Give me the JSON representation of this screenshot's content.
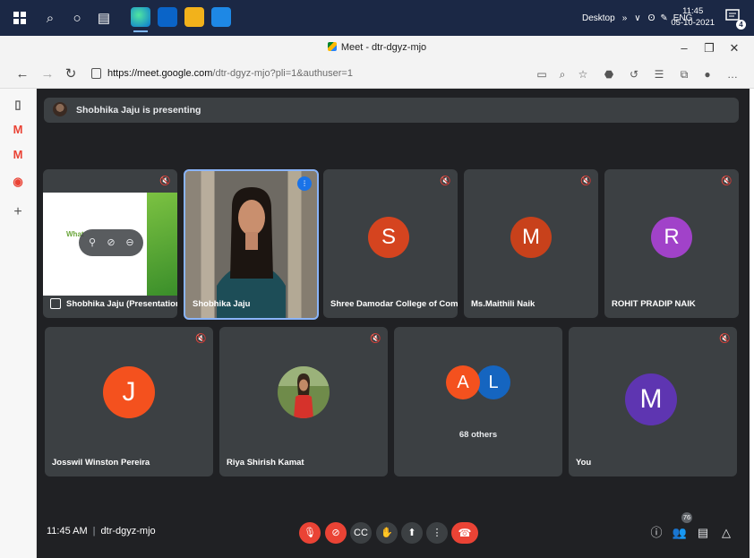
{
  "taskbar": {
    "tray_label": "Desktop",
    "lang": "ENG",
    "time": "11:45",
    "date": "05-10-2021",
    "notification_count": "4"
  },
  "browser": {
    "tab_title": "Meet - dtr-dgyz-mjo",
    "url_domain": "https://meet.google.com",
    "url_rest": "/dtr-dgyz-mjo?pli=1&authuser=1"
  },
  "meet": {
    "banner": "Shobhika Jaju is presenting",
    "presentation_tile": {
      "name": "Shobhika Jaju (Presentation)",
      "slide_text": "What"
    },
    "tiles": [
      {
        "name": "Shobhika Jaju"
      },
      {
        "name": "Shree Damodar College of Commer...",
        "initial": "S",
        "color": "#d5441f"
      },
      {
        "name": "Ms.Maithili Naik",
        "initial": "M",
        "color": "#c8411b"
      },
      {
        "name": "ROHIT PRADIP NAIK",
        "initial": "R",
        "color": "#a142c9"
      },
      {
        "name": "Josswil Winston Pereira",
        "initial": "J",
        "color": "#f4511e"
      },
      {
        "name": "Riya Shirish Kamat"
      },
      {
        "name": "",
        "others_label": "68 others",
        "initial_a": "A",
        "color_a": "#f4511e",
        "initial_b": "L",
        "color_b": "#1565c0"
      },
      {
        "name": "You",
        "initial": "M",
        "color": "#5e35b1"
      }
    ],
    "bottom": {
      "time": "11:45 AM",
      "meeting_code": "dtr-dgyz-mjo",
      "participant_count": "76"
    }
  }
}
